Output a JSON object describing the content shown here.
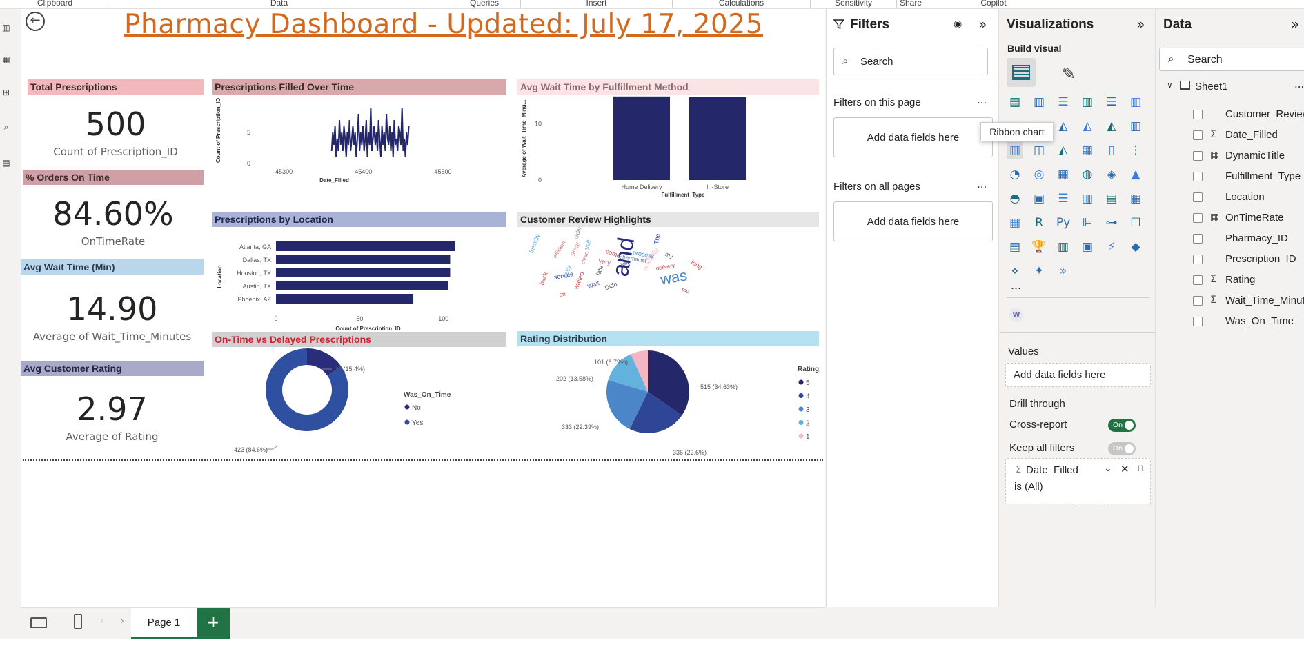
{
  "ribbon": {
    "groups": [
      "Clipboard",
      "Data",
      "Queries",
      "Insert",
      "Calculations",
      "Sensitivity",
      "Share",
      "Copilot"
    ]
  },
  "report": {
    "title": "Pharmacy Dashboard - Updated: July 17, 2025",
    "kpis": [
      {
        "header": "Total Prescriptions",
        "value": "500",
        "label": "Count of Prescription_ID",
        "color": "#f2b8bb"
      },
      {
        "header": "% Orders On Time",
        "value": "84.60%",
        "label": "OnTimeRate",
        "color": "#cfa0a6"
      },
      {
        "header": "Avg Wait Time (Min)",
        "value": "14.90",
        "label": "Average of Wait_Time_Minutes",
        "color": "#b9d6ea"
      },
      {
        "header": "Avg Customer Rating",
        "value": "2.97",
        "label": "Average of Rating",
        "color": "#a9a9c9"
      }
    ],
    "visual_headers": {
      "filled_over_time": "Prescriptions Filled Over Time",
      "wait_by_method": "Avg Wait Time by Fulfillment Method",
      "by_location": "Prescriptions by Location",
      "review_highlights": "Customer Review Highlights",
      "ontime_vs_delayed": "On-Time vs Delayed Prescriptions",
      "rating_distribution": "Rating Distribution"
    }
  },
  "chart_data": [
    {
      "type": "line",
      "title": "Prescriptions Filled Over Time",
      "xlabel": "Date_Filled",
      "ylabel": "Count of Prescription_ID",
      "xlim": [
        45270,
        45500
      ],
      "ylim": [
        0,
        10
      ],
      "xticks": [
        "45300",
        "45400",
        "45500"
      ],
      "yticks": [
        "0",
        "5"
      ],
      "series": [
        {
          "values": [
            2,
            5,
            3,
            6,
            1,
            4,
            2,
            7,
            3,
            5,
            2,
            6,
            4,
            1,
            5,
            3,
            7,
            2,
            4,
            6,
            3,
            5,
            1,
            4,
            8,
            2,
            5,
            3,
            6,
            2,
            4,
            7,
            1,
            5,
            3,
            9,
            2,
            4,
            6,
            3,
            5,
            2,
            7,
            4,
            1,
            6,
            3,
            5,
            2,
            8,
            4,
            3,
            6,
            2,
            5,
            1,
            7,
            3,
            4,
            2,
            6,
            5,
            3,
            9,
            2,
            4,
            1,
            5,
            3,
            6
          ]
        }
      ],
      "x_range": [
        45360,
        45457
      ]
    },
    {
      "type": "bar",
      "title": "Avg Wait Time by Fulfillment Method",
      "categories": [
        "Home Delivery",
        "In-Store"
      ],
      "values": [
        14.9,
        14.8
      ],
      "xlabel": "Fulfillment_Type",
      "ylabel": "Average of Wait_Time_Minu...",
      "ylim": [
        0,
        15
      ],
      "yticks": [
        "0",
        "10"
      ]
    },
    {
      "type": "bar",
      "orientation": "horizontal",
      "title": "Prescriptions by Location",
      "categories": [
        "Atlanta, GA",
        "Dallas, TX",
        "Houston, TX",
        "Austin, TX",
        "Phoenix, AZ"
      ],
      "values": [
        107,
        104,
        104,
        103,
        82
      ],
      "xlabel": "Count of Prescription_ID",
      "ylabel": "Location",
      "xlim": [
        0,
        110
      ],
      "xticks": [
        "0",
        "50",
        "100"
      ]
    },
    {
      "type": "pie",
      "donut": true,
      "title": "On-Time vs Delayed Prescriptions",
      "legend_title": "Was_On_Time",
      "legend_position": "right",
      "slices": [
        {
          "name": "No",
          "value": 77,
          "label": "77 (15.4%)",
          "color": "#2b2d7a"
        },
        {
          "name": "Yes",
          "value": 423,
          "label": "423 (84.6%)",
          "color": "#2f4fa0"
        }
      ]
    },
    {
      "type": "pie",
      "title": "Rating Distribution",
      "legend_title": "Rating",
      "legend_position": "right",
      "slices": [
        {
          "name": "5",
          "value": 515,
          "label": "515 (34.63%)",
          "color": "#25276b"
        },
        {
          "name": "4",
          "value": 336,
          "label": "336 (22.6%)",
          "color": "#2f4596"
        },
        {
          "name": "3",
          "value": 333,
          "label": "333 (22.39%)",
          "color": "#4b87c8"
        },
        {
          "name": "2",
          "value": 202,
          "label": "202 (13.58%)",
          "color": "#63b1dd"
        },
        {
          "name": "1",
          "value": 101,
          "label": "101 (6.79%)",
          "color": "#f3b6c4"
        }
      ]
    }
  ],
  "word_cloud": [
    {
      "w": "and",
      "c": "#2b2d7a"
    },
    {
      "w": "was",
      "c": "#4b87c8"
    },
    {
      "w": "friendly",
      "c": "#63b1dd"
    },
    {
      "w": "staff",
      "c": "#6fa8dc"
    },
    {
      "w": "great",
      "c": "#d48c8c"
    },
    {
      "w": "efficient",
      "c": "#e06c6c"
    },
    {
      "w": "order",
      "c": "#888"
    },
    {
      "w": "helpful",
      "c": "#f3b6c4"
    },
    {
      "w": "come",
      "c": "#c44"
    },
    {
      "w": "process",
      "c": "#4b87c8"
    },
    {
      "w": "Pharmacist",
      "c": "#4b87c8"
    },
    {
      "w": "Very",
      "c": "#d07080"
    },
    {
      "w": "service",
      "c": "#2f4596"
    },
    {
      "w": "delivery",
      "c": "#d04050"
    },
    {
      "w": "my",
      "c": "#555"
    },
    {
      "w": "long",
      "c": "#c44"
    },
    {
      "w": "too",
      "c": "#d04050"
    },
    {
      "w": "back",
      "c": "#c44"
    },
    {
      "w": "waited",
      "c": "#c44"
    },
    {
      "w": "easy",
      "c": "#63b1dd"
    },
    {
      "w": "Wait",
      "c": "#6a6aa8"
    },
    {
      "w": "late",
      "c": "#555"
    },
    {
      "w": "Didn",
      "c": "#555"
    },
    {
      "w": "on",
      "c": "#c44"
    },
    {
      "w": "The",
      "c": "#2f4596"
    },
    {
      "w": "clean",
      "c": "#d07080"
    },
    {
      "w": "pickup",
      "c": "#f3b6c4"
    },
    {
      "w": "slow",
      "c": "#2b2d7a"
    }
  ],
  "tabs": {
    "page1": "Page 1",
    "add": "+"
  },
  "filters": {
    "title": "Filters",
    "search_placeholder": "Search",
    "on_this_page": "Filters on this page",
    "on_all_pages": "Filters on all pages",
    "add_fields": "Add data fields here",
    "more": "..."
  },
  "viz": {
    "title": "Visualizations",
    "build_visual": "Build visual",
    "tooltip": "Ribbon chart",
    "more": "...",
    "values_label": "Values",
    "add_fields": "Add data fields here",
    "drill_through": "Drill through",
    "cross_report": "Cross-report",
    "cross_report_state": "On",
    "keep_all_filters": "Keep all filters",
    "keep_all_state": "On",
    "filter_field": "Date_Filled",
    "filter_value": "is (All)",
    "sigma": "Σ"
  },
  "data_pane": {
    "title": "Data",
    "search_placeholder": "Search",
    "table": "Sheet1",
    "more": "...",
    "fields": [
      {
        "name": "Customer_Review",
        "icon": ""
      },
      {
        "name": "Date_Filled",
        "icon": "Σ"
      },
      {
        "name": "DynamicTitle",
        "icon": "calc"
      },
      {
        "name": "Fulfillment_Type",
        "icon": ""
      },
      {
        "name": "Location",
        "icon": ""
      },
      {
        "name": "OnTimeRate",
        "icon": "calc"
      },
      {
        "name": "Pharmacy_ID",
        "icon": ""
      },
      {
        "name": "Prescription_ID",
        "icon": ""
      },
      {
        "name": "Rating",
        "icon": "Σ"
      },
      {
        "name": "Wait_Time_Minutes",
        "icon": "Σ"
      },
      {
        "name": "Was_On_Time",
        "icon": ""
      }
    ]
  }
}
